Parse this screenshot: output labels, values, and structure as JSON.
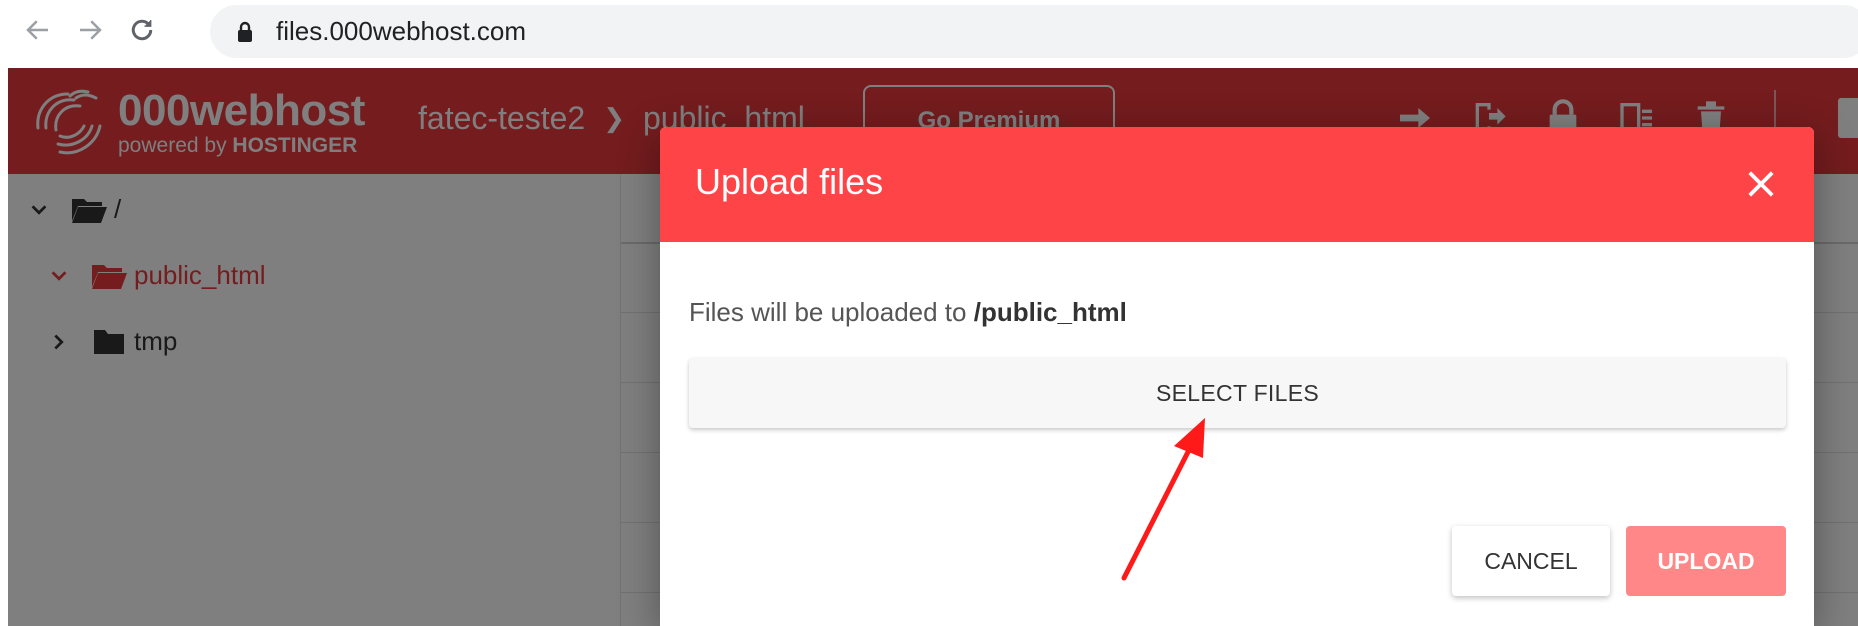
{
  "browser": {
    "url": "files.000webhost.com",
    "icons": [
      "back-arrow-icon",
      "forward-arrow-icon",
      "reload-icon",
      "lock-icon"
    ]
  },
  "app": {
    "logo_name": "000webhost",
    "logo_sub_prefix": "powered by",
    "logo_sub_brand": "HOSTINGER",
    "breadcrumb": [
      "fatec-teste2",
      "public_html"
    ],
    "premium_label": "Go Premium",
    "toolbar_icons": [
      "move-icon",
      "export-icon",
      "lock-icon",
      "permissions-icon",
      "trash-icon"
    ],
    "brand_color": "#e8383d"
  },
  "sidebar": {
    "items": [
      {
        "label": "/",
        "state": "expanded",
        "icon": "folder-open-icon"
      },
      {
        "label": "public_html",
        "state": "expanded",
        "icon": "folder-open-icon",
        "active": true
      },
      {
        "label": "tmp",
        "state": "collapsed",
        "icon": "folder-icon"
      }
    ]
  },
  "modal": {
    "title": "Upload files",
    "info_prefix": "Files will be uploaded to",
    "info_path": "/public_html",
    "select_label": "SELECT FILES",
    "cancel_label": "CANCEL",
    "upload_label": "UPLOAD",
    "header_color": "#ff4447",
    "upload_color": "#ff8787"
  }
}
